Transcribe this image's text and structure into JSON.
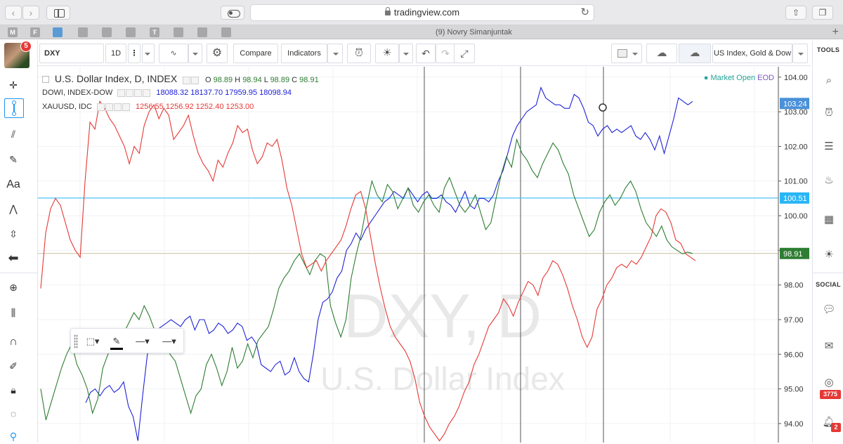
{
  "browser": {
    "url": "tradingview.com",
    "tab_title": "(9) Novry Simanjuntak",
    "favicons": [
      "M",
      "F",
      "",
      "",
      "",
      "",
      "T",
      "",
      "",
      ""
    ]
  },
  "toolbar": {
    "symbol": "DXY",
    "interval": "1D",
    "compare_label": "Compare",
    "indicators_label": "Indicators",
    "layout_name": "US Index, Gold & Dow"
  },
  "user": {
    "notification_count": "5"
  },
  "right_panel": {
    "tools_header": "TOOLS",
    "social_header": "SOCIAL",
    "stream_count": "3775",
    "alerts_count": "2"
  },
  "legend": {
    "main": {
      "name": "U.S. Dollar Index, D, INDEX",
      "o_label": "O",
      "o": "98.89",
      "h_label": "H",
      "h": "98.94",
      "l_label": "L",
      "l": "98.89",
      "c_label": "C",
      "c": "98.91"
    },
    "dowi": {
      "name": "DOWI, INDEX-DOW",
      "values": "18088.32  18137.70  17959.95  18098.94"
    },
    "xauusd": {
      "name": "XAUUSD, IDC",
      "values": "1256.55  1256.92  1252.40  1253.00"
    }
  },
  "market_status": {
    "label": "Market Open",
    "mode": "EOD"
  },
  "watermark": {
    "symbol": "DXY, D",
    "description": "U.S. Dollar Index"
  },
  "colors": {
    "dxy": "#1f22d6",
    "dowi": "#2e7d32",
    "xauusd": "#e53935",
    "hline": "#4fc3f7",
    "accent": "#2196f3"
  },
  "chart_data": {
    "type": "line",
    "y_axis": {
      "ticks": [
        "104.00",
        "103.00",
        "102.00",
        "101.00",
        "100.00",
        "99.00",
        "98.00",
        "97.00",
        "96.00",
        "95.00",
        "94.00"
      ],
      "ylim": [
        93.45,
        104.3
      ]
    },
    "price_labels": [
      {
        "value": "103.24",
        "color": "#4a90d9"
      },
      {
        "value": "100.51",
        "color": "#29b6f6"
      },
      {
        "value": "98.91",
        "color": "#2e7d32"
      }
    ],
    "horizontal_line": 100.51,
    "series": [
      {
        "name": "U.S. Dollar Index",
        "values": [
          94.6,
          94.9,
          95,
          94.8,
          95,
          95.1,
          94.9,
          95,
          95.2,
          94.5,
          94.2,
          93.5,
          94.8,
          96,
          96.3,
          96.7,
          96.8,
          96.9,
          97,
          96.9,
          96.8,
          97,
          97.1,
          96.7,
          97,
          97,
          96.6,
          96.7,
          96.9,
          96.8,
          96.6,
          96.7,
          96.9,
          96.8,
          96.4,
          96.5,
          96.3,
          95.7,
          95.6,
          95.5,
          95.7,
          95.8,
          95.4,
          95.5,
          95.9,
          95.5,
          95.3,
          95.2,
          96,
          97,
          97.5,
          97.6,
          97.8,
          98.2,
          98.4,
          99,
          99.2,
          99.5,
          99.3,
          99.6,
          99.8,
          100,
          100.2,
          100.4,
          100.5,
          100.7,
          100.6,
          100.5,
          100.8,
          100.6,
          100.4,
          100.6,
          100.7,
          100.5,
          100.5,
          100.6,
          100.4,
          100.3,
          100.1,
          100.4,
          100.7,
          100.3,
          100.2,
          100.5,
          100.5,
          100.4,
          100.6,
          101,
          101.3,
          101.8,
          102.3,
          102.6,
          102.8,
          103,
          103.1,
          103.2,
          103.7,
          103.4,
          103.3,
          103.2,
          103.2,
          103.1,
          103.1,
          103.5,
          103.4,
          103.1,
          102.7,
          102.6,
          102.3,
          102.5,
          102.6,
          102.4,
          102.5,
          102.4,
          102.5,
          102.6,
          102.3,
          102.2,
          102.4,
          102.2,
          101.9,
          102.3,
          101.8,
          102.3,
          102.8,
          103.4,
          103.3,
          103.2,
          103.3
        ]
      },
      {
        "name": "DOWI, INDEX-DOW",
        "values": [
          95,
          94.1,
          94.6,
          95.1,
          95.6,
          96,
          96.3,
          95.7,
          95.4,
          95,
          94.3,
          94.7,
          95.6,
          96,
          96.4,
          96.2,
          96.6,
          96.9,
          97.2,
          97,
          97.4,
          97.1,
          96.7,
          96.5,
          96.3,
          96,
          95.8,
          95.3,
          94.8,
          94.3,
          94.8,
          95,
          95.7,
          96,
          95.6,
          95.1,
          95.5,
          96.2,
          95.6,
          95.8,
          96.3,
          95.9,
          96.4,
          96.6,
          96.8,
          97.3,
          97.9,
          98.2,
          98.4,
          98.7,
          98.9,
          98.6,
          98.3,
          98.7,
          98.9,
          98.8,
          97.4,
          96.9,
          96.5,
          97,
          98.2,
          98.9,
          99.5,
          100.3,
          101,
          100.6,
          100.4,
          100.9,
          100.7,
          100.2,
          100.5,
          100.8,
          100.3,
          100.1,
          100.4,
          100.6,
          100.3,
          100.1,
          100.8,
          101.1,
          100.7,
          100.3,
          100.1,
          100.3,
          100.6,
          100.1,
          99.6,
          99.8,
          100.5,
          101.2,
          101.7,
          101.4,
          102.2,
          101.8,
          101.6,
          101.3,
          101.1,
          101.5,
          101.8,
          102.1,
          101.9,
          101.5,
          101.2,
          100.6,
          100.2,
          99.8,
          99.4,
          99.6,
          100.1,
          100.4,
          100.6,
          100.3,
          100.5,
          100.8,
          101,
          100.7,
          100.2,
          99.8,
          99.6,
          99.4,
          99.7,
          99.3,
          99.1,
          99,
          98.9,
          98.95,
          98.91
        ]
      },
      {
        "name": "XAUUSD, IDC",
        "values": [
          97.9,
          99.5,
          100.2,
          100.5,
          100.3,
          99.8,
          99.3,
          99,
          98.8,
          101,
          102.7,
          102.5,
          103.3,
          103.1,
          102.8,
          102.6,
          102.3,
          102,
          101.5,
          102,
          101.8,
          102.6,
          103,
          103.2,
          102.8,
          103.1,
          102.9,
          102.2,
          102.4,
          102.6,
          102.9,
          102.3,
          101.8,
          101.5,
          101.3,
          101,
          101.6,
          101.4,
          101.8,
          102.1,
          102.6,
          102.4,
          102.5,
          101.9,
          101.5,
          101.7,
          102.1,
          102,
          102.2,
          101.6,
          100.8,
          100.3,
          99.6,
          98.9,
          98.5,
          98.6,
          98.7,
          98.4,
          98.7,
          98.9,
          99.1,
          99.3,
          99.7,
          100.2,
          100.6,
          100.7,
          100.2,
          99.4,
          98.6,
          97.9,
          97.3,
          96.8,
          96.5,
          96.3,
          96.1,
          95.8,
          95.3,
          94.6,
          94.2,
          93.9,
          93.7,
          93.5,
          93.7,
          94,
          94.2,
          94.5,
          94.9,
          95.2,
          95.7,
          96,
          96.4,
          96.8,
          97,
          97.2,
          97.6,
          97.4,
          97.1,
          97.5,
          97.8,
          98.1,
          98,
          97.7,
          98.2,
          98.4,
          98.7,
          98.6,
          98.3,
          97.9,
          97.4,
          97,
          96.5,
          96.2,
          96.5,
          97.3,
          97.6,
          98,
          98.2,
          98.5,
          98.6,
          98.5,
          98.7,
          98.6,
          98.8,
          99.1,
          99.4,
          100,
          100.2,
          100.1,
          99.8,
          99.3,
          99.2,
          98.9,
          98.8,
          98.7
        ]
      }
    ],
    "grid": true,
    "legend_placement": "top-left"
  }
}
